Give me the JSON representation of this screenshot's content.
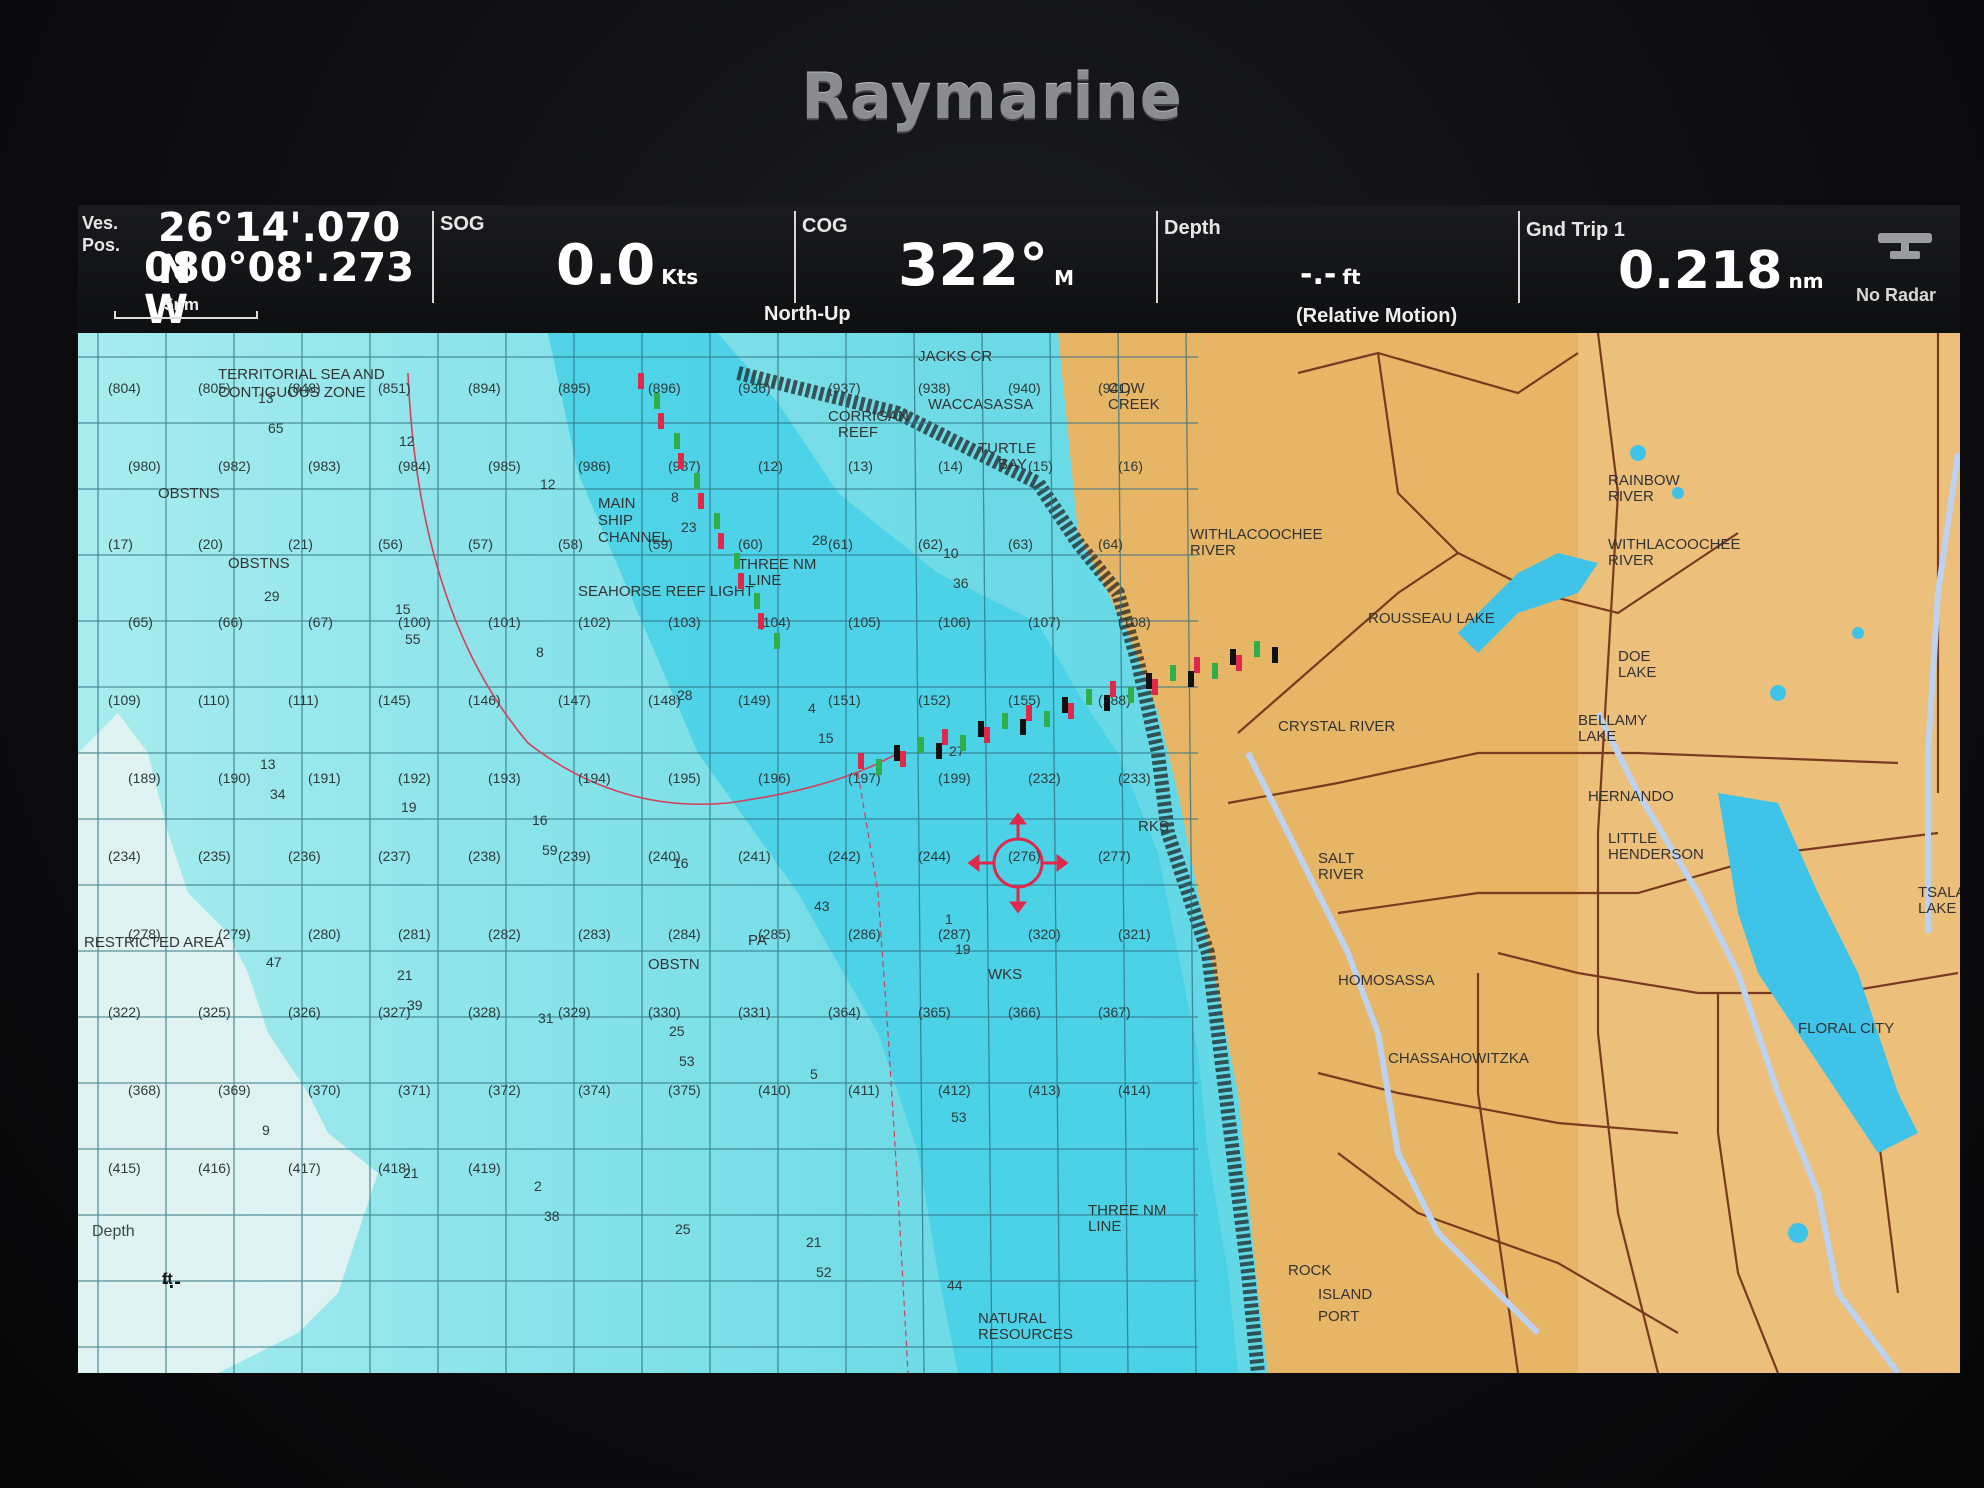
{
  "device": {
    "brand": "Raymarine"
  },
  "databar": {
    "vessel_position": {
      "label_line1": "Ves.",
      "label_line2": "Pos.",
      "latitude": "26°14'.070 N",
      "longitude": "080°08'.273 W",
      "scale": "5nm"
    },
    "sog": {
      "label": "SOG",
      "value": "0.0",
      "unit": "Kts"
    },
    "cog": {
      "label": "COG",
      "value": "322°",
      "unit": "M",
      "orientation": "North-Up"
    },
    "depth": {
      "label": "Depth",
      "value": "-.-",
      "unit": "ft",
      "motion_mode": "(Relative Motion)"
    },
    "trip": {
      "label": "Gnd Trip 1",
      "value": "0.218",
      "unit": "nm"
    },
    "radar": {
      "status": "No Radar",
      "icon": "radar-antenna-icon"
    }
  },
  "chart": {
    "place_labels": [
      "TERRITORIAL SEA AND",
      "CONTIGUOUS ZONE",
      "OBSTNS",
      "OBSTNS",
      "MAIN",
      "SHIP",
      "CHANNEL",
      "SEAHORSE REEF LIGHT",
      "THREE NM",
      "LINE",
      "CORRIGAN",
      "REEF",
      "TURTLE",
      "BAY",
      "WACCASASSA",
      "COW",
      "CREEK",
      "JACKS CR",
      "WITHLACOOCHEE",
      "RIVER",
      "RAINBOW",
      "RIVER",
      "WITHLACOOCHEE",
      "RIVER",
      "ROUSSEAU LAKE",
      "CRYSTAL RIVER",
      "BELLAMY",
      "LAKE",
      "HERNANDO",
      "LITTLE",
      "HENDERSON",
      "SALT",
      "RIVER",
      "HOMOSASSA",
      "CHASSAHOWITZKA",
      "RESTRICTED AREA",
      "THREE NM",
      "LINE",
      "ROCK",
      "ISLAND",
      "PORT",
      "NATURAL",
      "RESOURCES",
      "OBSTN",
      "PA",
      "WKS",
      "RKS",
      "TSALA",
      "LAKE",
      "FLORAL CITY",
      "DOE",
      "LAKE"
    ],
    "grid_cells": [
      "(804)",
      "(805)",
      "(848)",
      "(851)",
      "(894)",
      "(895)",
      "(896)",
      "(936)",
      "(937)",
      "(938)",
      "(940)",
      "(941)",
      "(980)",
      "(982)",
      "(983)",
      "(984)",
      "(985)",
      "(986)",
      "(987)",
      "(12)",
      "(13)",
      "(14)",
      "(15)",
      "(16)",
      "(17)",
      "(20)",
      "(21)",
      "(56)",
      "(57)",
      "(58)",
      "(59)",
      "(60)",
      "(61)",
      "(62)",
      "(63)",
      "(64)",
      "(65)",
      "(66)",
      "(67)",
      "(100)",
      "(101)",
      "(102)",
      "(103)",
      "(104)",
      "(105)",
      "(106)",
      "(107)",
      "(108)",
      "(109)",
      "(110)",
      "(111)",
      "(145)",
      "(146)",
      "(147)",
      "(148)",
      "(149)",
      "(151)",
      "(152)",
      "(155)",
      "(188)",
      "(189)",
      "(190)",
      "(191)",
      "(192)",
      "(193)",
      "(194)",
      "(195)",
      "(196)",
      "(197)",
      "(199)",
      "(232)",
      "(233)",
      "(234)",
      "(235)",
      "(236)",
      "(237)",
      "(238)",
      "(239)",
      "(240)",
      "(241)",
      "(242)",
      "(244)",
      "(276)",
      "(277)",
      "(278)",
      "(279)",
      "(280)",
      "(281)",
      "(282)",
      "(283)",
      "(284)",
      "(285)",
      "(286)",
      "(287)",
      "(320)",
      "(321)",
      "(322)",
      "(325)",
      "(326)",
      "(327)",
      "(328)",
      "(329)",
      "(330)",
      "(331)",
      "(364)",
      "(365)",
      "(366)",
      "(367)",
      "(368)",
      "(369)",
      "(370)",
      "(371)",
      "(372)",
      "(374)",
      "(375)",
      "(410)",
      "(411)",
      "(412)",
      "(413)",
      "(414)",
      "(415)",
      "(416)",
      "(417)",
      "(418)",
      "(419)"
    ],
    "soundings": [
      "13",
      "15",
      "16",
      "25",
      "21",
      "10",
      "13",
      "21",
      "2",
      "8",
      "4",
      "1",
      "9",
      "12",
      "8",
      "16",
      "5",
      "44",
      "29",
      "19",
      "31",
      "25",
      "28",
      "27",
      "47",
      "21",
      "12",
      "28",
      "43",
      "53",
      "65",
      "55",
      "59",
      "53",
      "52",
      "36",
      "34",
      "39",
      "38",
      "23",
      "15",
      "19"
    ],
    "depth_overlay": {
      "label": "Depth",
      "value": "-.-",
      "unit": "ft"
    },
    "colors": {
      "shallow_water": "#4fd6e6",
      "deep_water": "#8fe6ea",
      "land": "#e7b25f",
      "land_dark": "#c48a3c",
      "grid_lines": "#2f6f80",
      "roads": "#7a3a20",
      "marsh": "#1c1c1c"
    }
  }
}
